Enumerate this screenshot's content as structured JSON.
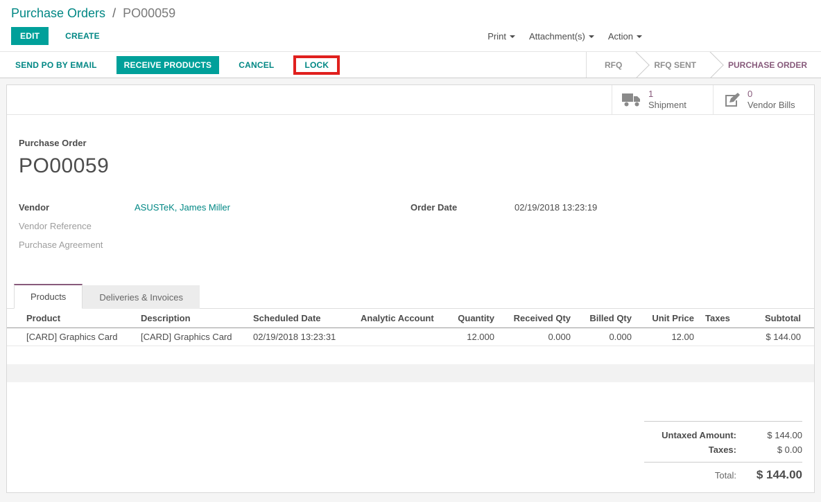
{
  "colors": {
    "accent_teal": "#00a09a",
    "link_teal": "#008784",
    "active_state_purple": "#875a7b",
    "annotation_red": "#e0201e"
  },
  "breadcrumb": {
    "parent": "Purchase Orders",
    "separator": "/",
    "current": "PO00059"
  },
  "toolbar": {
    "edit_label": "EDIT",
    "create_label": "CREATE",
    "menus": [
      {
        "label": "Print"
      },
      {
        "label": "Attachment(s)"
      },
      {
        "label": "Action"
      }
    ]
  },
  "statusbar": {
    "send_po_label": "SEND PO BY EMAIL",
    "receive_label": "RECEIVE PRODUCTS",
    "cancel_label": "CANCEL",
    "lock_label": "LOCK",
    "states": [
      {
        "label": "RFQ"
      },
      {
        "label": "RFQ SENT"
      },
      {
        "label": "PURCHASE ORDER"
      }
    ]
  },
  "stat_buttons": [
    {
      "icon": "truck-icon",
      "value": "1",
      "label": "Shipment"
    },
    {
      "icon": "pencil-square-icon",
      "value": "0",
      "label": "Vendor Bills"
    }
  ],
  "sheet": {
    "doc_label": "Purchase Order",
    "doc_name": "PO00059",
    "fields": {
      "vendor_label": "Vendor",
      "vendor_value": "ASUSTeK, James Miller",
      "vendor_reference_label": "Vendor Reference",
      "purchase_agreement_label": "Purchase Agreement",
      "order_date_label": "Order Date",
      "order_date_value": "02/19/2018 13:23:19"
    },
    "tabs": [
      {
        "label": "Products"
      },
      {
        "label": "Deliveries & Invoices"
      }
    ],
    "table": {
      "headers": [
        "Product",
        "Description",
        "Scheduled Date",
        "Analytic Account",
        "Quantity",
        "Received Qty",
        "Billed Qty",
        "Unit Price",
        "Taxes",
        "Subtotal"
      ],
      "rows": [
        {
          "cells": [
            "[CARD] Graphics Card",
            "[CARD] Graphics Card",
            "02/19/2018 13:23:31",
            "",
            "12.000",
            "0.000",
            "0.000",
            "12.00",
            "",
            "$ 144.00"
          ]
        }
      ]
    },
    "totals": {
      "untaxed_label": "Untaxed Amount:",
      "untaxed_value": "$ 144.00",
      "taxes_label": "Taxes:",
      "taxes_value": "$ 0.00",
      "total_label": "Total:",
      "total_value": "$ 144.00"
    }
  }
}
